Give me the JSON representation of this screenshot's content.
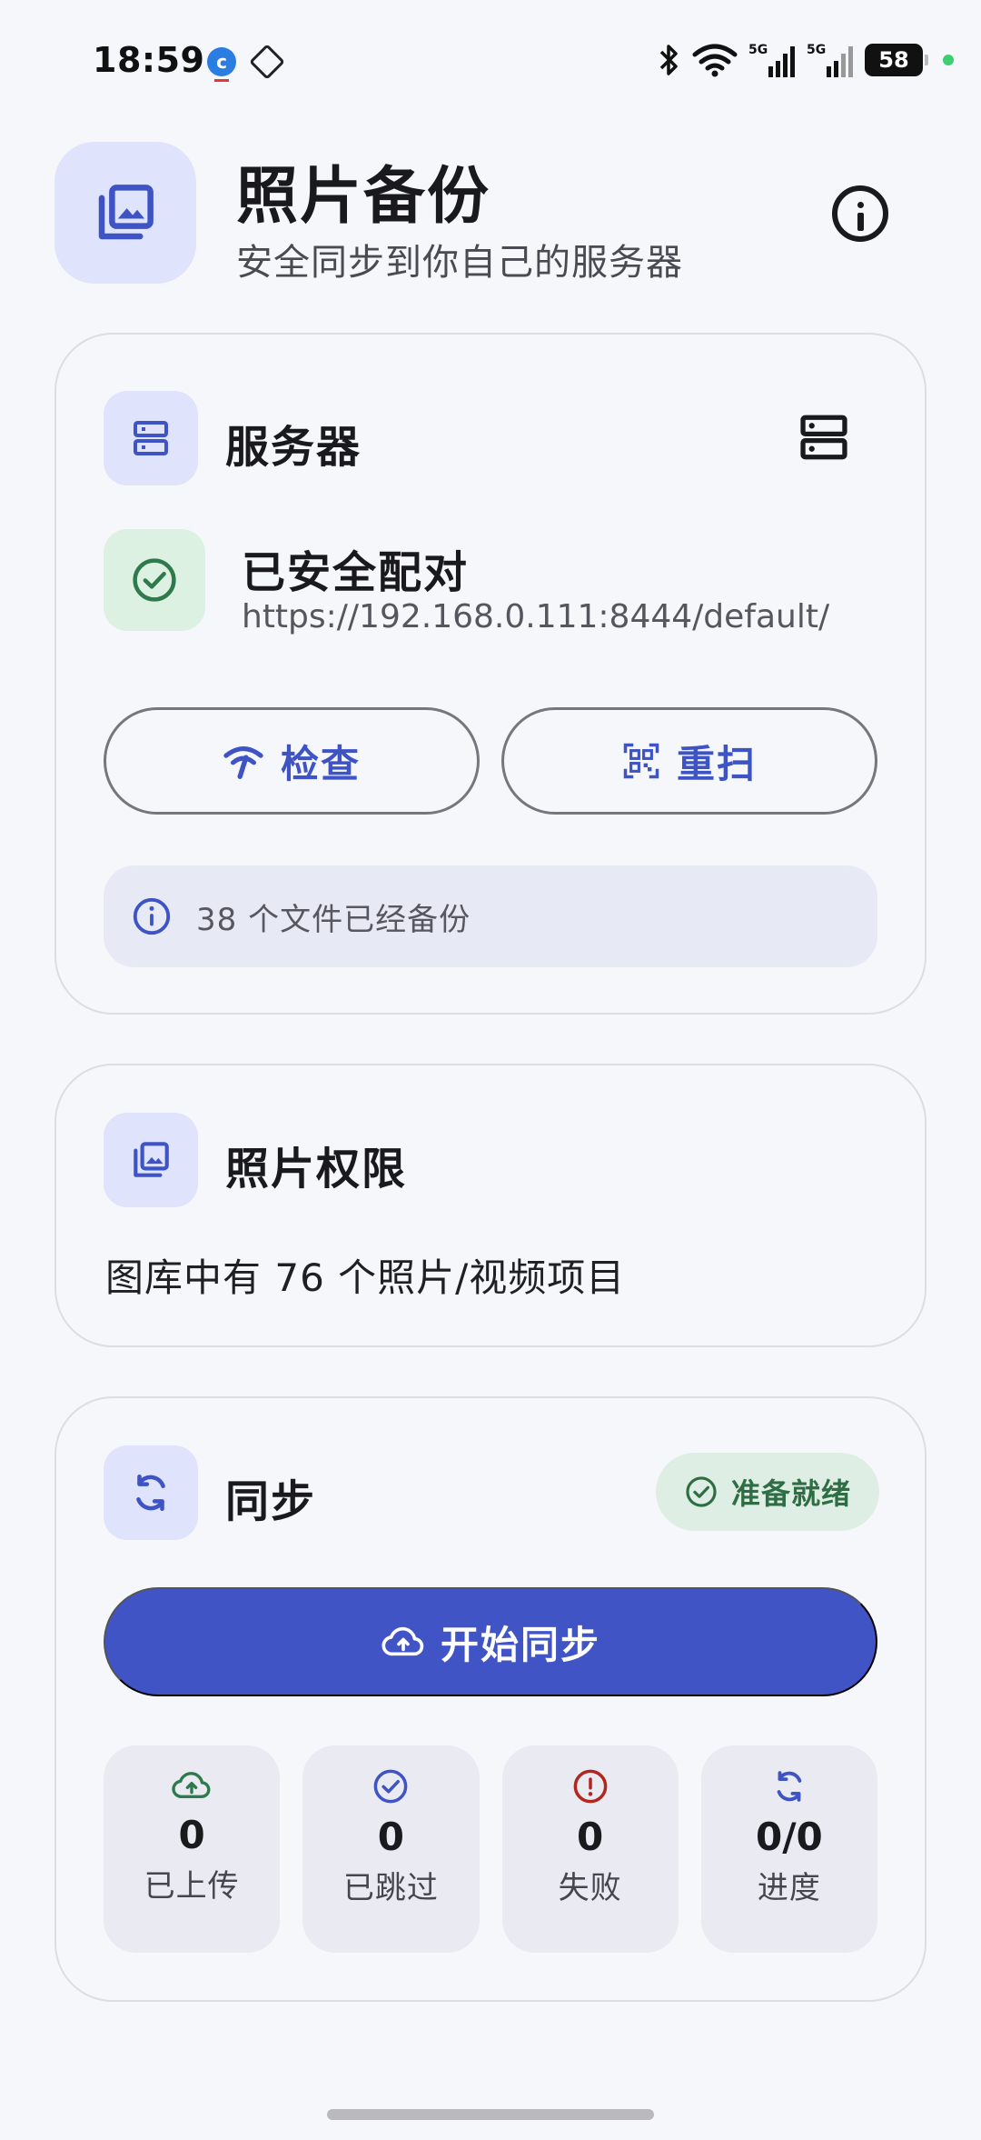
{
  "status_bar": {
    "time": "18:59",
    "battery": "58",
    "icons": [
      "bluetooth-icon",
      "wifi-icon",
      "5g-signal-icon",
      "5g-signal-icon"
    ]
  },
  "header": {
    "title": "照片备份",
    "subtitle": "安全同步到你自己的服务器",
    "icon": "photo-library-icon"
  },
  "server_card": {
    "title": "服务器",
    "pair_status": "已安全配对",
    "server_url": "https://192.168.0.111:8444/default/",
    "check_label": "检查",
    "rescan_label": "重扫",
    "backed_up_note": "38 个文件已经备份"
  },
  "permission_card": {
    "title": "照片权限",
    "library_info": "图库中有 76 个照片/视频项目"
  },
  "sync_card": {
    "title": "同步",
    "status_chip": "准备就绪",
    "start_label": "开始同步",
    "stats": [
      {
        "value": "0",
        "label": "已上传",
        "icon": "cloud-upload-icon",
        "color": "#2f7a4c"
      },
      {
        "value": "0",
        "label": "已跳过",
        "icon": "check-circle-icon",
        "color": "#3f54c4"
      },
      {
        "value": "0",
        "label": "失败",
        "icon": "error-circle-icon",
        "color": "#b3261e"
      },
      {
        "value": "0/0",
        "label": "进度",
        "icon": "sync-icon",
        "color": "#3f54c4"
      }
    ]
  },
  "colors": {
    "accent": "#4154c5",
    "success": "#2f6e44",
    "tile_bg": "#dfe3fb"
  }
}
